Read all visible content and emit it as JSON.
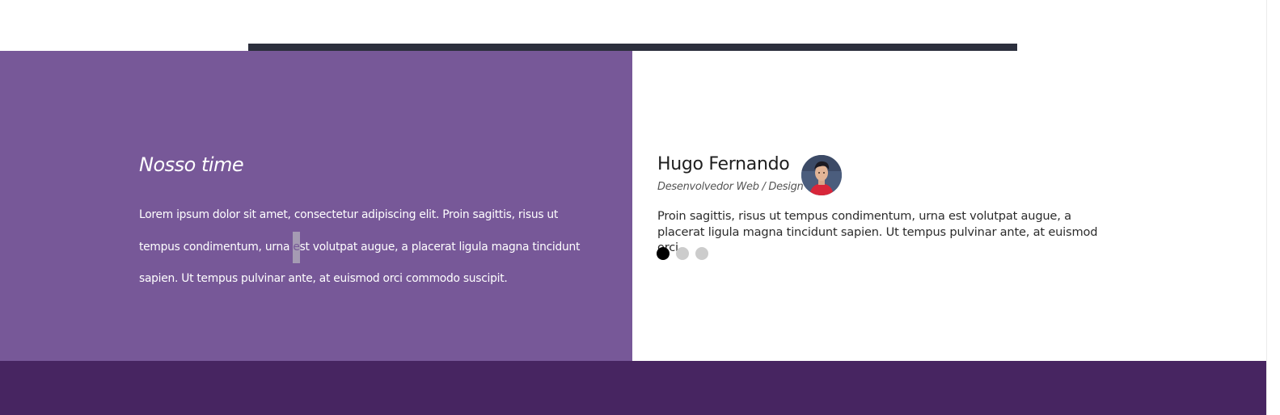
{
  "colors": {
    "team_left_bg": "#775898",
    "dark_banner": "#2c2f3d",
    "footer_band": "#472561",
    "dot_active": "#000000",
    "dot_inactive": "#cccccc"
  },
  "team": {
    "title": "Nosso time",
    "text_before_caret": "Lorem ipsum dolor sit amet, consectetur adipiscing elit. Proin sagittis, risus ut tempus condimentum, urna ",
    "text_caret_char": "e",
    "text_after_caret": "st volutpat augue, a placerat ligula magna tincidunt sapien. Ut tempus pulvinar ante, at euismod orci commodo suscipit."
  },
  "testimonial": {
    "name": "Hugo Fernando",
    "role": "Desenvolvedor Web / Design",
    "quote": "Proin sagittis, risus ut tempus condimentum, urna est volutpat augue, a placerat ligula magna tincidunt sapien. Ut tempus pulvinar ante, at euismod orci.",
    "avatar_icon": "person-avatar",
    "slides_total": 3,
    "active_slide": 1
  }
}
